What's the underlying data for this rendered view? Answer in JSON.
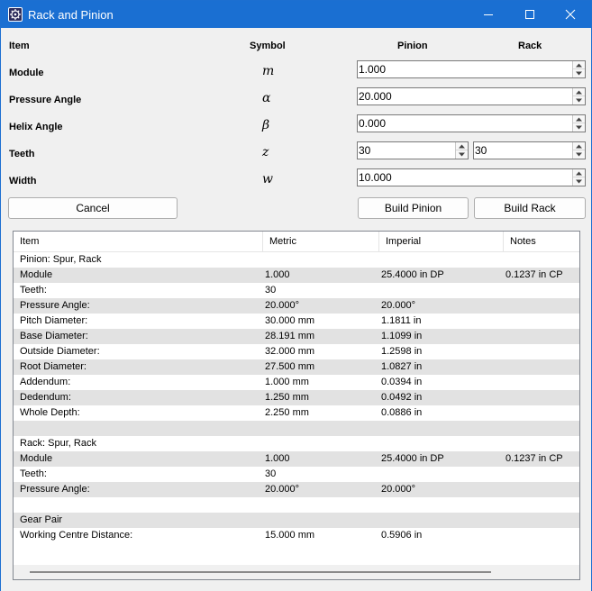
{
  "window": {
    "title": "Rack and Pinion",
    "icon": "gear-app-icon"
  },
  "header": {
    "item": "Item",
    "symbol": "Symbol",
    "pinion": "Pinion",
    "rack": "Rack"
  },
  "params": [
    {
      "label": "Module",
      "symbol": "m",
      "value": "1.000"
    },
    {
      "label": "Pressure Angle",
      "symbol": "α",
      "value": "20.000"
    },
    {
      "label": "Helix Angle",
      "symbol": "β",
      "value": "0.000"
    },
    {
      "label": "Teeth",
      "symbol": "z",
      "pinion_value": "30",
      "rack_value": "30"
    },
    {
      "label": "Width",
      "symbol": "w",
      "value": "10.000"
    }
  ],
  "buttons": {
    "cancel": "Cancel",
    "build_pinion": "Build Pinion",
    "build_rack": "Build Rack"
  },
  "results": {
    "columns": [
      "Item",
      "Metric",
      "Imperial",
      "Notes"
    ],
    "rows": [
      [
        "Pinion: Spur, Rack",
        "",
        "",
        ""
      ],
      [
        "Module",
        "1.000",
        "25.4000 in DP",
        "0.1237 in CP"
      ],
      [
        "Teeth:",
        "30",
        "",
        ""
      ],
      [
        "Pressure Angle:",
        "20.000°",
        "20.000°",
        ""
      ],
      [
        "Pitch Diameter:",
        "30.000 mm",
        "1.1811 in",
        ""
      ],
      [
        "Base Diameter:",
        "28.191 mm",
        "1.1099 in",
        ""
      ],
      [
        "Outside Diameter:",
        "32.000 mm",
        "1.2598 in",
        ""
      ],
      [
        "Root Diameter:",
        "27.500 mm",
        "1.0827 in",
        ""
      ],
      [
        "Addendum:",
        "1.000 mm",
        "0.0394 in",
        ""
      ],
      [
        "Dedendum:",
        "1.250 mm",
        "0.0492 in",
        ""
      ],
      [
        "Whole Depth:",
        "2.250 mm",
        "0.0886 in",
        ""
      ],
      [
        "",
        "",
        "",
        ""
      ],
      [
        "Rack: Spur, Rack",
        "",
        "",
        ""
      ],
      [
        "Module",
        "1.000",
        "25.4000 in DP",
        "0.1237 in CP"
      ],
      [
        "Teeth:",
        "30",
        "",
        ""
      ],
      [
        "Pressure Angle:",
        "20.000°",
        "20.000°",
        ""
      ],
      [
        "",
        "",
        "",
        ""
      ],
      [
        "Gear Pair",
        "",
        "",
        ""
      ],
      [
        "Working Centre Distance:",
        "15.000 mm",
        "0.5906 in",
        ""
      ]
    ]
  }
}
